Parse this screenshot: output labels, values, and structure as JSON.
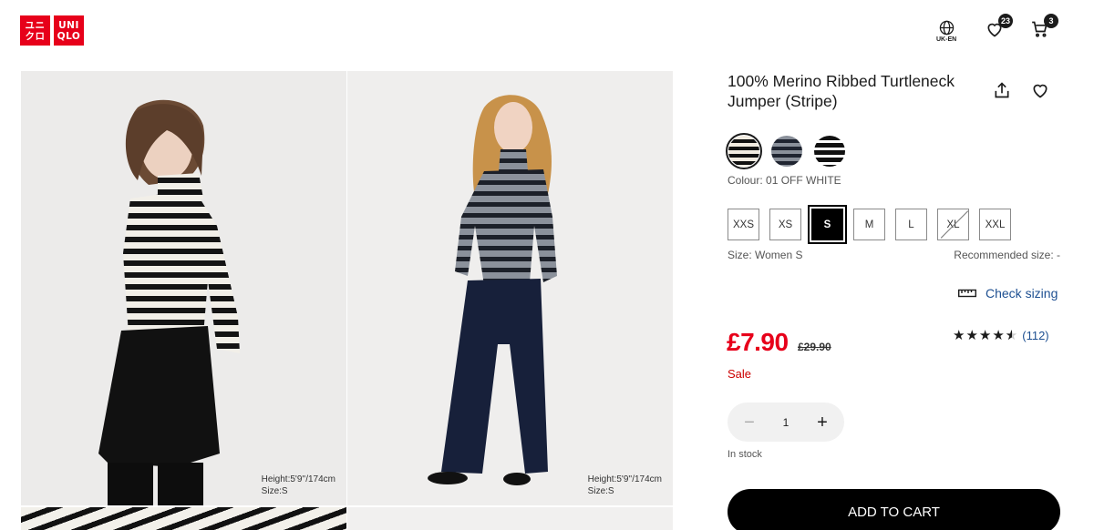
{
  "header": {
    "logo_lines": [
      "UNI",
      "QLO"
    ],
    "logo_kanji": [
      "ユニ",
      "クロ"
    ],
    "locale_label": "UK-EN",
    "wishlist_count": "23",
    "cart_count": "3"
  },
  "gallery": {
    "photos": [
      {
        "caption_height": "Height:5'9''/174cm",
        "caption_size": "Size:S"
      },
      {
        "caption_height": "Height:5'9''/174cm",
        "caption_size": "Size:S"
      }
    ]
  },
  "product": {
    "title": "100% Merino Ribbed Turtleneck Jumper (Stripe)",
    "swatches": [
      {
        "name": "off-white stripe",
        "colors": [
          "#f1ebe0",
          "#111111"
        ],
        "selected": true
      },
      {
        "name": "grey stripe",
        "colors": [
          "#8a909a",
          "#1f2430"
        ],
        "selected": false
      },
      {
        "name": "black stripe",
        "colors": [
          "#ffffff",
          "#111111"
        ],
        "selected": false
      }
    ],
    "colour_label": "Colour: 01 OFF WHITE",
    "sizes": [
      "XXS",
      "XS",
      "S",
      "M",
      "L",
      "XL",
      "XXL"
    ],
    "selected_size": "S",
    "unavailable_sizes": [
      "XL"
    ],
    "size_label": "Size: Women S",
    "recommended_size": "Recommended size: -",
    "check_sizing": "Check sizing",
    "price": "£7.90",
    "old_price": "£29.90",
    "sale_label": "Sale",
    "rating_stars": 4.5,
    "rating_count": "(112)",
    "quantity": "1",
    "stock_label": "In stock",
    "add_to_cart": "ADD TO CART"
  },
  "colors": {
    "brand_red": "#e7001a",
    "link_blue": "#1d4f91"
  }
}
